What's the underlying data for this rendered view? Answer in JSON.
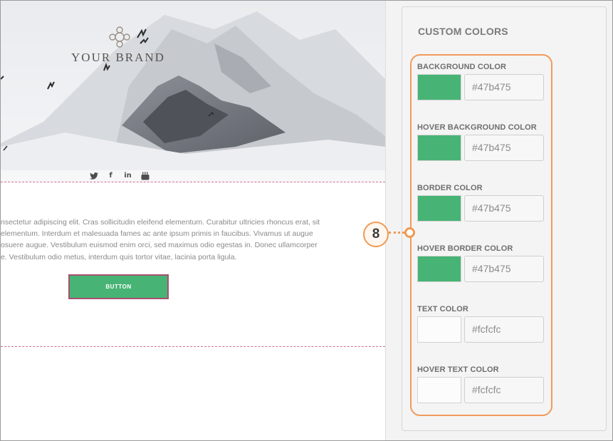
{
  "preview": {
    "brand_name": "YOUR BRAND",
    "social_icons": [
      "twitter-icon",
      "facebook-icon",
      "linkedin-icon",
      "youtube-icon"
    ],
    "body_lines": [
      "nsectetur adipiscing elit. Cras sollicitudin eleifend elementum. Curabitur ultricies rhoncus erat, sit",
      "elementum. Interdum et malesuada fames ac ante ipsum primis in faucibus. Vivamus ut augue",
      "osuere augue. Vestibulum euismod enim orci, sed maximus odio egestas in. Donec ullamcorper",
      "e. Vestibulum odio metus, interdum quis tortor vitae, lacinia porta ligula."
    ],
    "button_label": "BUTTON",
    "button_color": "#47b475",
    "button_border_color": "#a94f6f"
  },
  "panel": {
    "title": "CUSTOM COLORS",
    "fields": [
      {
        "label": "BACKGROUND COLOR",
        "value": "#47b475",
        "swatch": "#47b475"
      },
      {
        "label": "HOVER BACKGROUND COLOR",
        "value": "#47b475",
        "swatch": "#47b475"
      },
      {
        "label": "BORDER COLOR",
        "value": "#47b475",
        "swatch": "#47b475"
      },
      {
        "label": "HOVER BORDER COLOR",
        "value": "#47b475",
        "swatch": "#47b475"
      },
      {
        "label": "TEXT COLOR",
        "value": "#fcfcfc",
        "swatch": "#fcfcfc"
      },
      {
        "label": "HOVER TEXT COLOR",
        "value": "#fcfcfc",
        "swatch": "#fcfcfc"
      }
    ]
  },
  "callout": {
    "number": "8",
    "accent_color": "#ef9a55"
  }
}
